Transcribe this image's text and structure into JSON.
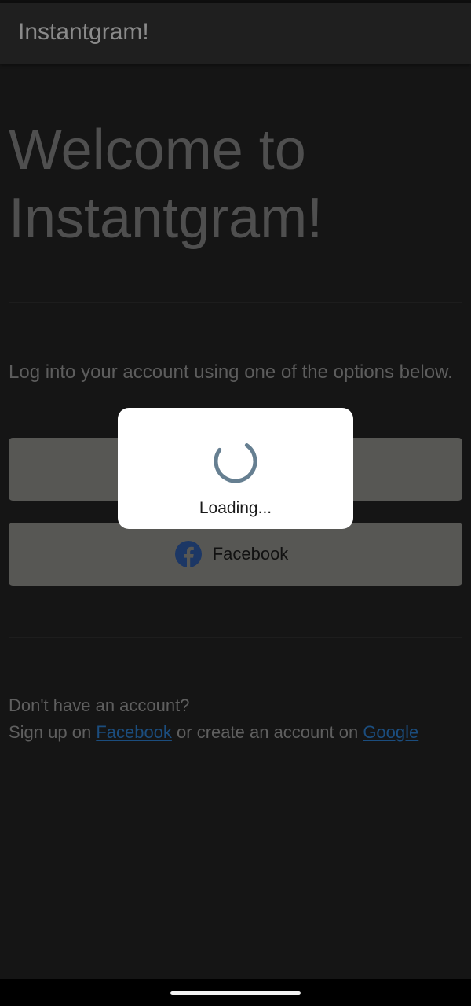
{
  "app_bar": {
    "title": "Instantgram!"
  },
  "welcome": {
    "line1": "Welcome to",
    "line2": "Instantgram!"
  },
  "intro": {
    "text": "Log into your account using one of the options below."
  },
  "buttons": {
    "facebook_label": "Facebook",
    "facebook_icon": "facebook-logo-icon"
  },
  "footer": {
    "question": "Don't have an account?",
    "signup_prefix": "Sign up on ",
    "facebook_link": "Facebook",
    "middle": " or create an account on ",
    "google_link": "Google"
  },
  "dialog": {
    "loading_text": "Loading...",
    "spinner_icon": "spinner-icon"
  },
  "colors": {
    "background": "#151515",
    "app_bar": "#1f1f1f",
    "button": "#575754",
    "facebook_brand": "#1c3765",
    "link": "#1b4d7e",
    "spinner": "#667f91",
    "dialog": "#ffffff"
  }
}
